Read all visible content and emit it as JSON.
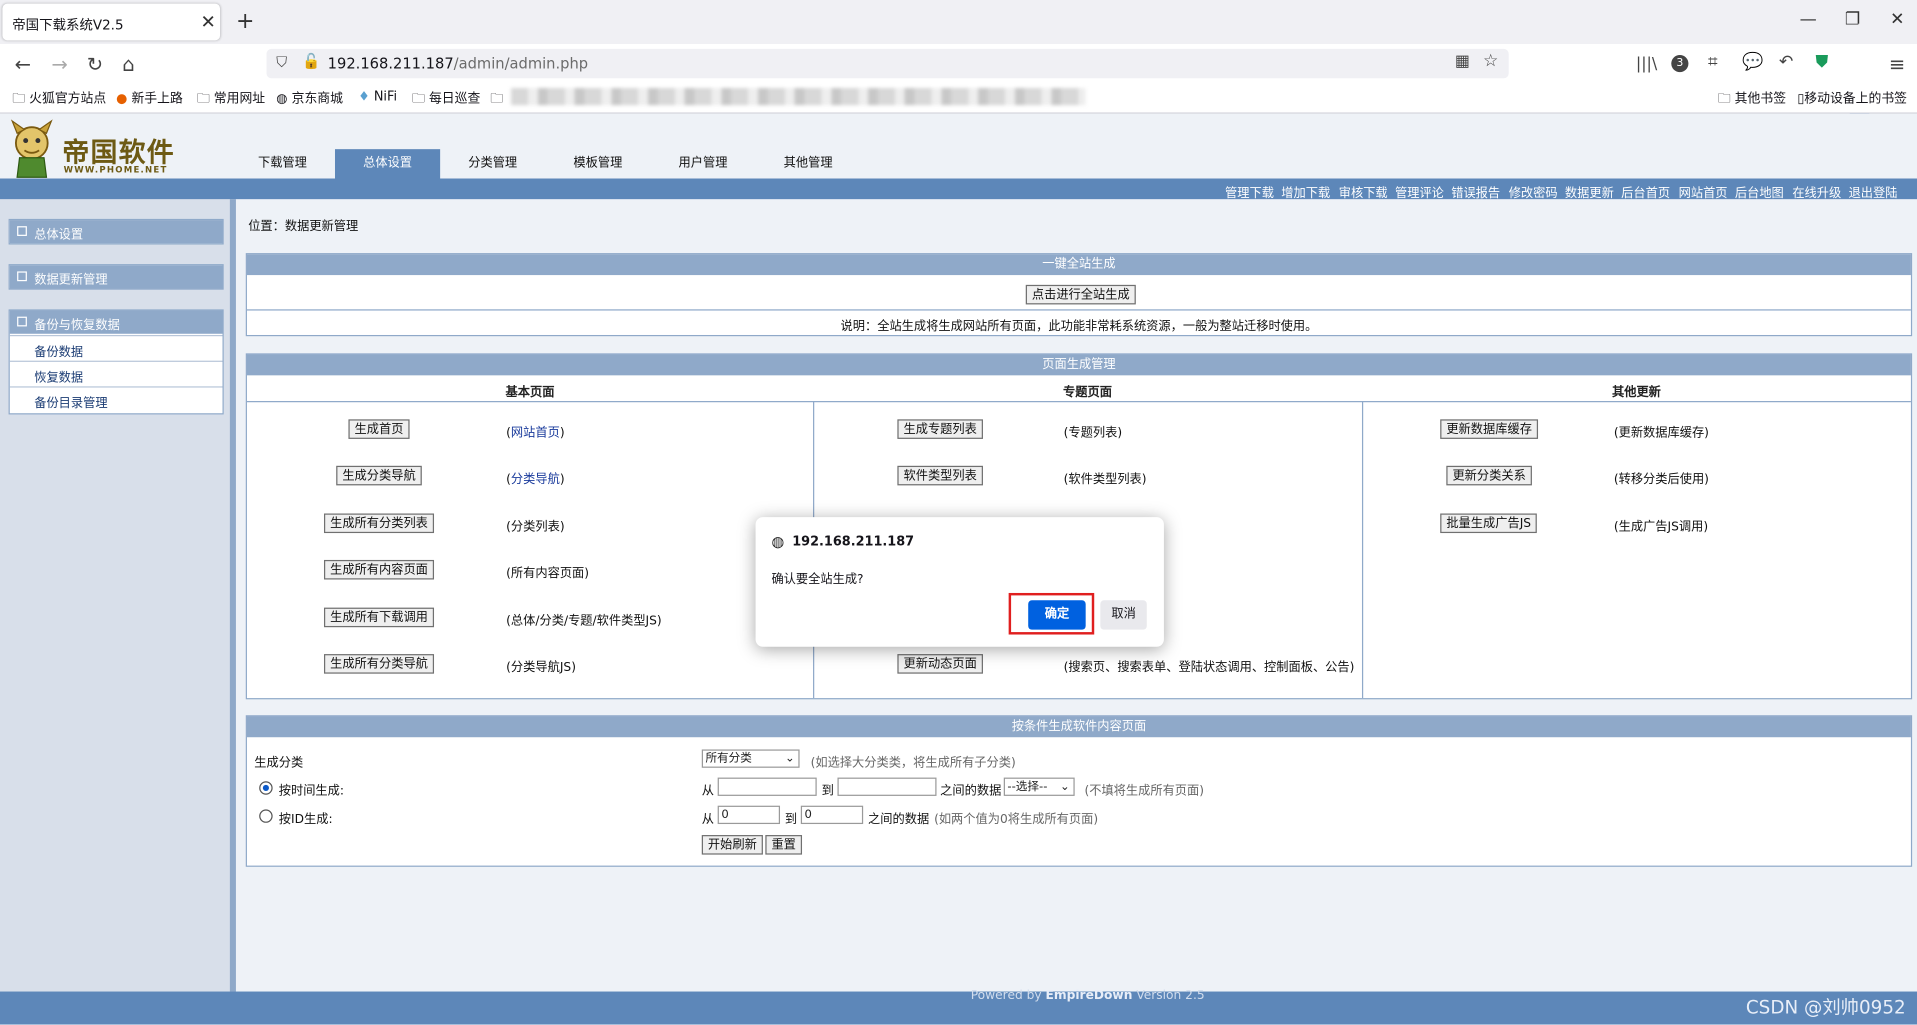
{
  "browser": {
    "tab_title": "帝国下载系统V2.5",
    "url_host": "192.168.211.187",
    "url_path": "/admin/admin.php",
    "bookmarks": [
      "火狐官方站点",
      "新手上路",
      "常用网址",
      "京东商城",
      "NiFi",
      "每日巡查"
    ],
    "bookmarks_right": [
      "其他书签",
      "移动设备上的书签"
    ],
    "extension_badge": "3"
  },
  "header": {
    "logo_text": "帝国软件",
    "logo_sub": "WWW.PHOME.NET",
    "main_tabs": [
      "下载管理",
      "总体设置",
      "分类管理",
      "模板管理",
      "用户管理",
      "其他管理"
    ],
    "top_links": [
      "管理下载",
      "增加下载",
      "审核下载",
      "管理评论",
      "错误报告",
      "修改密码",
      "数据更新",
      "后台首页",
      "网站首页",
      "后台地图",
      "在线升级",
      "退出登陆"
    ]
  },
  "sidebar": {
    "sections": [
      {
        "title": "总体设置",
        "items": []
      },
      {
        "title": "数据更新管理",
        "items": []
      },
      {
        "title": "备份与恢复数据",
        "items": [
          "备份数据",
          "恢复数据",
          "备份目录管理"
        ]
      }
    ]
  },
  "content": {
    "location": "位置：数据更新管理",
    "onekey": {
      "title": "一键全站生成",
      "button": "点击进行全站生成",
      "note": "说明：全站生成将生成网站所有页面，此功能非常耗系统资源，一般为整站迁移时使用。"
    },
    "pages": {
      "title": "页面生成管理",
      "col_heads": [
        "基本页面",
        "专题页面",
        "其他更新"
      ],
      "basic": [
        {
          "button": "生成首页",
          "desc": "(网站首页)",
          "linked": true
        },
        {
          "button": "生成分类导航",
          "desc": "(分类导航)",
          "linked": true
        },
        {
          "button": "生成所有分类列表",
          "desc": "(分类列表)",
          "linked": false
        },
        {
          "button": "生成所有内容页面",
          "desc": "(所有内容页面)",
          "linked": false
        },
        {
          "button": "生成所有下载调用",
          "desc": "(总体/分类/专题/软件类型JS)",
          "linked": false
        },
        {
          "button": "生成所有分类导航",
          "desc": "(分类导航JS)",
          "linked": false
        }
      ],
      "topic": [
        {
          "button": "生成专题列表",
          "desc": "(专题列表)"
        },
        {
          "button": "软件类型列表",
          "desc": "(软件类型列表)"
        },
        {
          "button": "更新动态页面",
          "desc": "(搜索页、搜索表单、登陆状态调用、控制面板、公告)"
        }
      ],
      "other": [
        {
          "button": "更新数据库缓存",
          "desc": "(更新数据库缓存)"
        },
        {
          "button": "更新分类关系",
          "desc": "(转移分类后使用)"
        },
        {
          "button": "批量生成广告JS",
          "desc": "(生成广告JS调用)"
        }
      ]
    },
    "condition": {
      "title": "按条件生成软件内容页面",
      "class_label": "生成分类",
      "class_select": "所有分类",
      "class_hint": "(如选择大分类类，将生成所有子分类)",
      "by_time_label": "按时间生成:",
      "by_id_label": "按ID生成:",
      "from": "从",
      "to": "到",
      "between_data": "之间的数据",
      "time_select": "--选择--",
      "time_hint": "(不填将生成所有页面)",
      "id_from": "0",
      "id_to": "0",
      "id_hint": "(如两个值为0将生成所有页面)",
      "start_button": "开始刷新",
      "reset_button": "重置",
      "mode_selected": "按时间生成:"
    }
  },
  "footer": {
    "powered": "Powered by",
    "product": "EmpireDown",
    "version": "Version 2.5",
    "watermark": "CSDN @刘帅0952"
  },
  "dialog": {
    "origin": "192.168.211.187",
    "message": "确认要全站生成?",
    "ok": "确定",
    "cancel": "取消",
    "highlight_color": "#e01f1f"
  }
}
